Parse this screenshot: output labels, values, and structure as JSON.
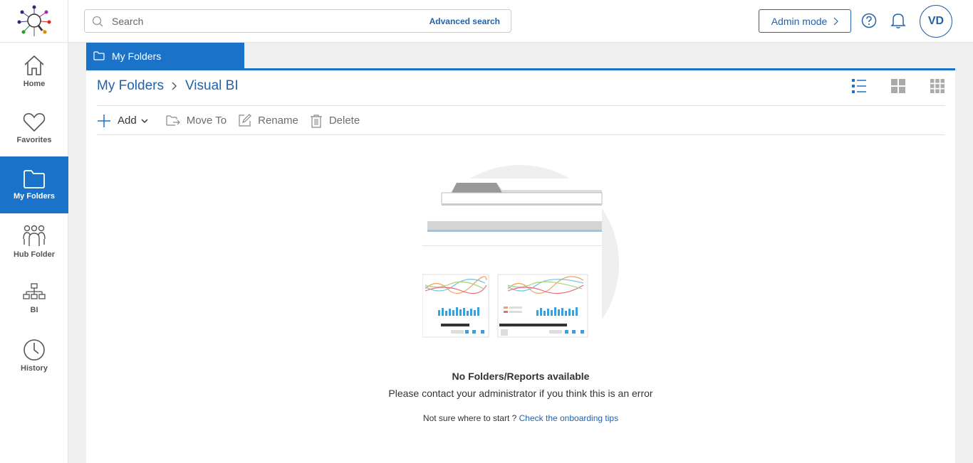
{
  "sidebar": {
    "items": [
      {
        "label": "Home",
        "icon": "home-icon"
      },
      {
        "label": "Favorites",
        "icon": "heart-icon"
      },
      {
        "label": "My Folders",
        "icon": "folder-icon",
        "active": true
      },
      {
        "label": "Hub Folder",
        "icon": "users-icon"
      },
      {
        "label": "BI",
        "icon": "hierarchy-icon"
      },
      {
        "label": "History",
        "icon": "clock-icon"
      }
    ]
  },
  "header": {
    "search_placeholder": "Search",
    "advanced_search": "Advanced search",
    "admin_mode": "Admin mode",
    "avatar_initials": "VD"
  },
  "tab": {
    "label": "My Folders"
  },
  "breadcrumb": {
    "root": "My Folders",
    "current": "Visual BI"
  },
  "toolbar": {
    "add": "Add",
    "move_to": "Move To",
    "rename": "Rename",
    "delete": "Delete"
  },
  "empty_state": {
    "title": "No Folders/Reports available",
    "message": "Please contact your administrator if you think this is an error",
    "tips_prefix": "Not sure where to start ?",
    "tips_link": "Check the onboarding tips"
  },
  "colors": {
    "accent": "#1a73c9",
    "link": "#2462a8"
  }
}
